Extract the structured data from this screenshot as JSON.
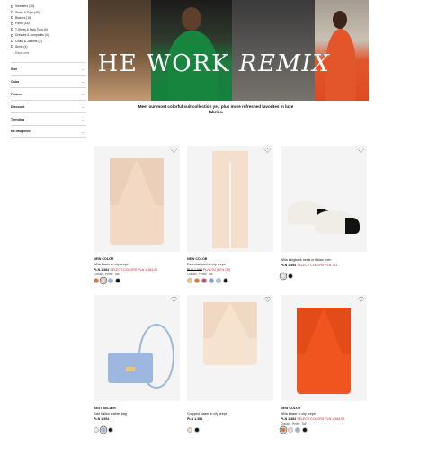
{
  "categories": [
    {
      "label": "Sweaters (36)"
    },
    {
      "label": "Shirts & Tops (45)"
    },
    {
      "label": "Blazers (18)"
    },
    {
      "label": "Pants (18)"
    },
    {
      "label": "T-Shirts & Tank Tops (6)"
    },
    {
      "label": "Dresses & Jumpsuits (4)"
    },
    {
      "label": "Coats & Jackets (4)"
    },
    {
      "label": "Skirts (4)"
    }
  ],
  "show_less": "– Show Less",
  "filters": [
    {
      "label": "Size"
    },
    {
      "label": "Color"
    },
    {
      "label": "Pattern"
    },
    {
      "label": "Discount"
    },
    {
      "label": "Trending"
    },
    {
      "label": "Re-Imagined"
    }
  ],
  "hero": {
    "title_plain": "HE WORK ",
    "title_italic": "REMIX"
  },
  "subtitle": "Meet our most colorful suit collection yet, plus more refreshed favorites in luxe fabrics.",
  "products": [
    {
      "badge": "NEW COLOR",
      "name": "Willa blazer in city crepe",
      "price": "PLN 1.384",
      "sale": "SELECT COLORS PLN 1.384.00",
      "colors_count": "Classic, Petite, Tall",
      "swatches": [
        "#e8702a",
        "#f1d9c3",
        "#8fb4e3",
        "#111111"
      ],
      "selected": 1
    },
    {
      "badge": "NEW COLOR",
      "name": "Essential pant in city crepe",
      "price": "PLN 1.084",
      "sale": "PLN 702 (40% Off)",
      "colors_count": "Classic, Petite, Tall",
      "swatches": [
        "#e9c96a",
        "#e8702a",
        "#d33a7c",
        "#6f9fd8",
        "#9bd0e8",
        "#111111"
      ],
      "selected": -1
    },
    {
      "badge": "",
      "name": "Willa slingback heels in Italian linen",
      "price": "PLN 1.494",
      "sale": "SELECT COLORS PLN 731",
      "colors_count": "",
      "swatches": [
        "#ece8e2",
        "#111111"
      ],
      "selected": 0
    },
    {
      "badge": "BEST SELLER",
      "name": "Edie Italian leather bag",
      "price": "PLN 1.394",
      "sale": "",
      "colors_count": "",
      "swatches": [
        "#ece8e2",
        "#9db7de",
        "#111111"
      ],
      "selected": 1
    },
    {
      "badge": "",
      "name": "Cropped blazer in city crepe",
      "price": "PLN 1.384",
      "sale": "",
      "colors_count": "",
      "swatches": [
        "#f1d9c3",
        "#111111"
      ],
      "selected": -1
    },
    {
      "badge": "NEW COLOR",
      "name": "Willa blazer in city crepe",
      "price": "PLN 1.384",
      "sale": "SELECT COLORS PLN 1.384.00",
      "colors_count": "Classic, Petite, Tall",
      "swatches": [
        "#e8702a",
        "#f1d9c3",
        "#8fb4e3",
        "#111111"
      ],
      "selected": 0
    }
  ]
}
